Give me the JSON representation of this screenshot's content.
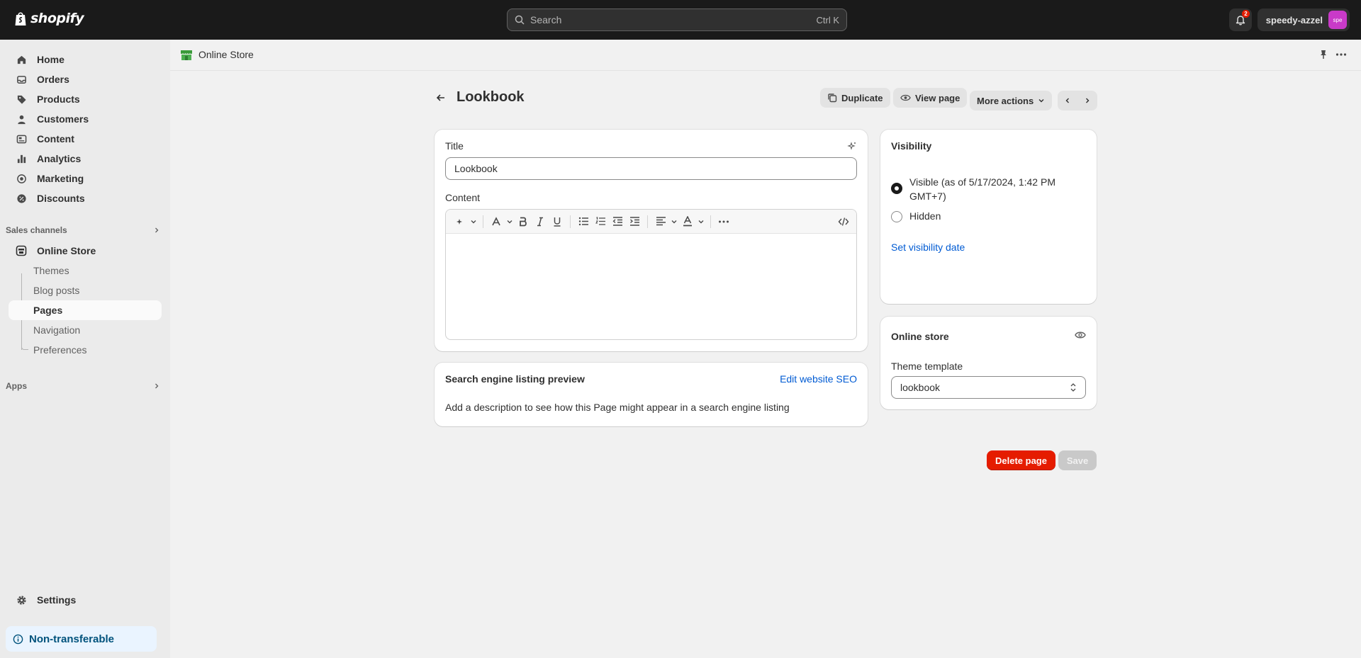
{
  "topbar": {
    "brand": "shopify",
    "search_placeholder": "Search",
    "search_shortcut": "Ctrl K",
    "notification_count": "2",
    "store_name": "speedy-azzel",
    "store_avatar": "spe",
    "avatar_color": "#c93ac8"
  },
  "sidebar": {
    "items": [
      {
        "label": "Home",
        "icon": "home-icon"
      },
      {
        "label": "Orders",
        "icon": "orders-icon"
      },
      {
        "label": "Products",
        "icon": "tag-icon"
      },
      {
        "label": "Customers",
        "icon": "person-icon"
      },
      {
        "label": "Content",
        "icon": "content-icon"
      },
      {
        "label": "Analytics",
        "icon": "chart-icon"
      },
      {
        "label": "Marketing",
        "icon": "target-icon"
      },
      {
        "label": "Discounts",
        "icon": "discount-icon"
      }
    ],
    "sales_channels_label": "Sales channels",
    "online_store_label": "Online Store",
    "sub_items": [
      "Themes",
      "Blog posts",
      "Pages",
      "Navigation",
      "Preferences"
    ],
    "active_sub_item": "Pages",
    "apps_label": "Apps",
    "settings_label": "Settings",
    "non_transferable_label": "Non-transferable"
  },
  "breadcrumb": {
    "label": "Online Store"
  },
  "page": {
    "title": "Lookbook",
    "duplicate_label": "Duplicate",
    "view_page_label": "View page",
    "more_actions_label": "More actions"
  },
  "editor_card": {
    "title_label": "Title",
    "title_value": "Lookbook",
    "content_label": "Content"
  },
  "seo_card": {
    "heading": "Search engine listing preview",
    "edit_link": "Edit website SEO",
    "description": "Add a description to see how this Page might appear in a search engine listing"
  },
  "visibility_card": {
    "heading": "Visibility",
    "visible_label_line1": "Visible (as of 5/17/2024, 1:42 PM",
    "visible_label_line2": "GMT+7)",
    "hidden_label": "Hidden",
    "selected": "Visible",
    "set_date_link": "Set visibility date"
  },
  "online_store_card": {
    "heading": "Online store",
    "template_label": "Theme template",
    "template_value": "lookbook"
  },
  "footer_actions": {
    "delete_label": "Delete page",
    "save_label": "Save",
    "delete_color": "#e51c00"
  }
}
